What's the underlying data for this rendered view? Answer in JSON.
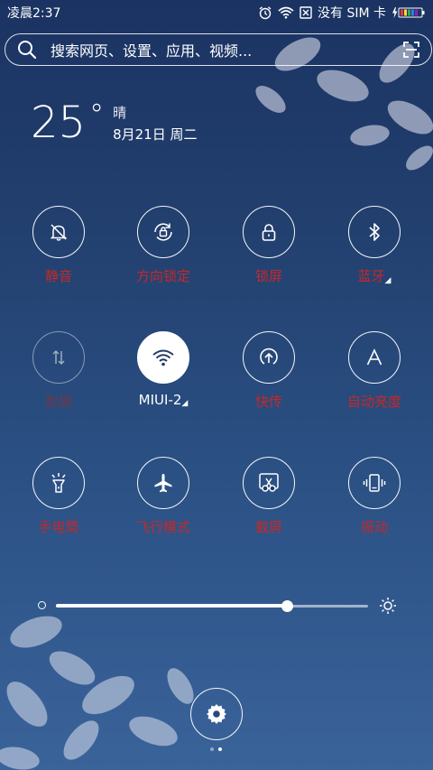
{
  "status_bar": {
    "time": "凌晨2:37",
    "sim_text": "没有 SIM 卡"
  },
  "search": {
    "placeholder": "搜索网页、设置、应用、视频..."
  },
  "weather": {
    "temperature": "25",
    "unit": "°",
    "condition": "晴",
    "date": "8月21日 周二"
  },
  "toggles": [
    {
      "label": "静音",
      "icon": "bell-off-icon",
      "state": "on"
    },
    {
      "label": "方向锁定",
      "icon": "rotation-lock-icon",
      "state": "on"
    },
    {
      "label": "锁屏",
      "icon": "lock-icon",
      "state": "on"
    },
    {
      "label": "蓝牙",
      "icon": "bluetooth-icon",
      "state": "on"
    },
    {
      "label": "数据",
      "icon": "data-arrows-icon",
      "state": "disabled"
    },
    {
      "label": "MIUI-2",
      "icon": "wifi-icon",
      "state": "active"
    },
    {
      "label": "快传",
      "icon": "upload-circle-icon",
      "state": "on"
    },
    {
      "label": "自动亮度",
      "icon": "letter-a-icon",
      "state": "on"
    },
    {
      "label": "手电筒",
      "icon": "flashlight-icon",
      "state": "on"
    },
    {
      "label": "飞行模式",
      "icon": "airplane-icon",
      "state": "on"
    },
    {
      "label": "截屏",
      "icon": "scissors-icon",
      "state": "on"
    },
    {
      "label": "振动",
      "icon": "vibrate-icon",
      "state": "on"
    }
  ],
  "brightness": {
    "level": 0.74
  },
  "colors": {
    "label_red": "#c62828",
    "background_top": "#1b3362",
    "background_bottom": "#3a639a"
  },
  "pager": {
    "page": 2,
    "total": 2
  }
}
